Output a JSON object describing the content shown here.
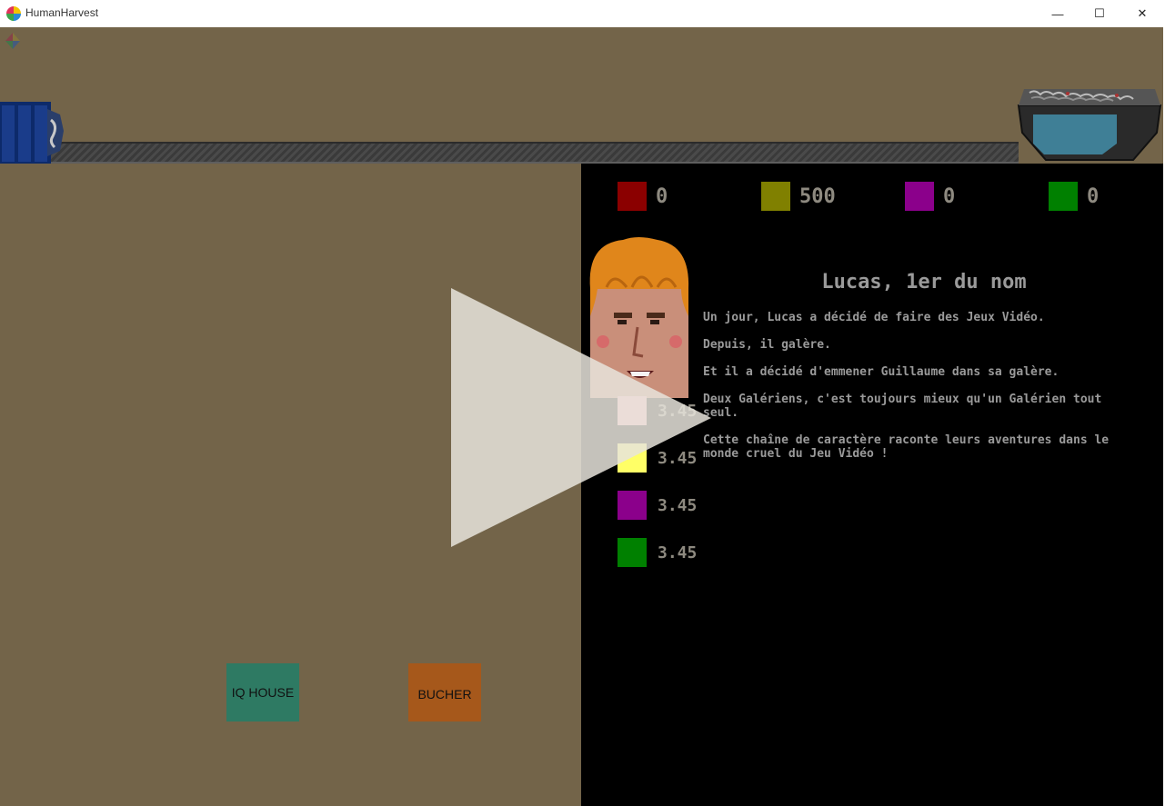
{
  "window": {
    "title": "HumanHarvest",
    "minimize_glyph": "—",
    "maximize_glyph": "☐",
    "close_glyph": "✕"
  },
  "resources": [
    {
      "color": "#8b0000",
      "value": "0"
    },
    {
      "color": "#808000",
      "value": "500"
    },
    {
      "color": "#8b008b",
      "value": "0"
    },
    {
      "color": "#008000",
      "value": "0"
    }
  ],
  "character": {
    "name": "Lucas, 1er du nom",
    "story": [
      "Un jour, Lucas a décidé de faire des Jeux Vidéo.",
      "Depuis, il galère.",
      "Et il a décidé d'emmener Guillaume dans sa galère.",
      "Deux Galériens, c'est toujours mieux qu'un Galérien tout seul.",
      "Cette chaîne de caractère raconte leurs aventures dans le monde cruel du Jeu Vidéo !"
    ]
  },
  "stats": [
    {
      "color": "#ffb6c1",
      "value": "3.45"
    },
    {
      "color": "#ffff66",
      "value": "3.45"
    },
    {
      "color": "#8b008b",
      "value": "3.45"
    },
    {
      "color": "#008000",
      "value": "3.45"
    }
  ],
  "buttons": {
    "iq_house": "IQ HOUSE",
    "bucher": "BUCHER"
  },
  "icons": {
    "app": "pinwheel-icon",
    "play_overlay": "play-icon",
    "spawner": "blue-crate-icon",
    "bin": "grinder-bin-icon"
  }
}
